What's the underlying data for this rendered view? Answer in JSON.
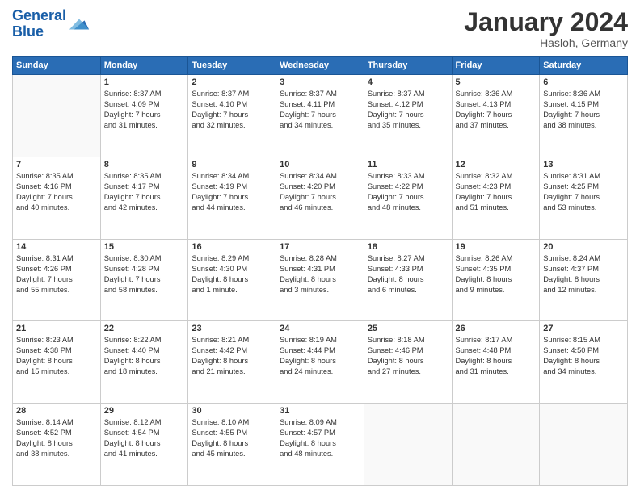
{
  "header": {
    "logo_line1": "General",
    "logo_line2": "Blue",
    "month_title": "January 2024",
    "location": "Hasloh, Germany"
  },
  "weekdays": [
    "Sunday",
    "Monday",
    "Tuesday",
    "Wednesday",
    "Thursday",
    "Friday",
    "Saturday"
  ],
  "weeks": [
    [
      {
        "day": "",
        "info": ""
      },
      {
        "day": "1",
        "info": "Sunrise: 8:37 AM\nSunset: 4:09 PM\nDaylight: 7 hours\nand 31 minutes."
      },
      {
        "day": "2",
        "info": "Sunrise: 8:37 AM\nSunset: 4:10 PM\nDaylight: 7 hours\nand 32 minutes."
      },
      {
        "day": "3",
        "info": "Sunrise: 8:37 AM\nSunset: 4:11 PM\nDaylight: 7 hours\nand 34 minutes."
      },
      {
        "day": "4",
        "info": "Sunrise: 8:37 AM\nSunset: 4:12 PM\nDaylight: 7 hours\nand 35 minutes."
      },
      {
        "day": "5",
        "info": "Sunrise: 8:36 AM\nSunset: 4:13 PM\nDaylight: 7 hours\nand 37 minutes."
      },
      {
        "day": "6",
        "info": "Sunrise: 8:36 AM\nSunset: 4:15 PM\nDaylight: 7 hours\nand 38 minutes."
      }
    ],
    [
      {
        "day": "7",
        "info": "Sunrise: 8:35 AM\nSunset: 4:16 PM\nDaylight: 7 hours\nand 40 minutes."
      },
      {
        "day": "8",
        "info": "Sunrise: 8:35 AM\nSunset: 4:17 PM\nDaylight: 7 hours\nand 42 minutes."
      },
      {
        "day": "9",
        "info": "Sunrise: 8:34 AM\nSunset: 4:19 PM\nDaylight: 7 hours\nand 44 minutes."
      },
      {
        "day": "10",
        "info": "Sunrise: 8:34 AM\nSunset: 4:20 PM\nDaylight: 7 hours\nand 46 minutes."
      },
      {
        "day": "11",
        "info": "Sunrise: 8:33 AM\nSunset: 4:22 PM\nDaylight: 7 hours\nand 48 minutes."
      },
      {
        "day": "12",
        "info": "Sunrise: 8:32 AM\nSunset: 4:23 PM\nDaylight: 7 hours\nand 51 minutes."
      },
      {
        "day": "13",
        "info": "Sunrise: 8:31 AM\nSunset: 4:25 PM\nDaylight: 7 hours\nand 53 minutes."
      }
    ],
    [
      {
        "day": "14",
        "info": "Sunrise: 8:31 AM\nSunset: 4:26 PM\nDaylight: 7 hours\nand 55 minutes."
      },
      {
        "day": "15",
        "info": "Sunrise: 8:30 AM\nSunset: 4:28 PM\nDaylight: 7 hours\nand 58 minutes."
      },
      {
        "day": "16",
        "info": "Sunrise: 8:29 AM\nSunset: 4:30 PM\nDaylight: 8 hours\nand 1 minute."
      },
      {
        "day": "17",
        "info": "Sunrise: 8:28 AM\nSunset: 4:31 PM\nDaylight: 8 hours\nand 3 minutes."
      },
      {
        "day": "18",
        "info": "Sunrise: 8:27 AM\nSunset: 4:33 PM\nDaylight: 8 hours\nand 6 minutes."
      },
      {
        "day": "19",
        "info": "Sunrise: 8:26 AM\nSunset: 4:35 PM\nDaylight: 8 hours\nand 9 minutes."
      },
      {
        "day": "20",
        "info": "Sunrise: 8:24 AM\nSunset: 4:37 PM\nDaylight: 8 hours\nand 12 minutes."
      }
    ],
    [
      {
        "day": "21",
        "info": "Sunrise: 8:23 AM\nSunset: 4:38 PM\nDaylight: 8 hours\nand 15 minutes."
      },
      {
        "day": "22",
        "info": "Sunrise: 8:22 AM\nSunset: 4:40 PM\nDaylight: 8 hours\nand 18 minutes."
      },
      {
        "day": "23",
        "info": "Sunrise: 8:21 AM\nSunset: 4:42 PM\nDaylight: 8 hours\nand 21 minutes."
      },
      {
        "day": "24",
        "info": "Sunrise: 8:19 AM\nSunset: 4:44 PM\nDaylight: 8 hours\nand 24 minutes."
      },
      {
        "day": "25",
        "info": "Sunrise: 8:18 AM\nSunset: 4:46 PM\nDaylight: 8 hours\nand 27 minutes."
      },
      {
        "day": "26",
        "info": "Sunrise: 8:17 AM\nSunset: 4:48 PM\nDaylight: 8 hours\nand 31 minutes."
      },
      {
        "day": "27",
        "info": "Sunrise: 8:15 AM\nSunset: 4:50 PM\nDaylight: 8 hours\nand 34 minutes."
      }
    ],
    [
      {
        "day": "28",
        "info": "Sunrise: 8:14 AM\nSunset: 4:52 PM\nDaylight: 8 hours\nand 38 minutes."
      },
      {
        "day": "29",
        "info": "Sunrise: 8:12 AM\nSunset: 4:54 PM\nDaylight: 8 hours\nand 41 minutes."
      },
      {
        "day": "30",
        "info": "Sunrise: 8:10 AM\nSunset: 4:55 PM\nDaylight: 8 hours\nand 45 minutes."
      },
      {
        "day": "31",
        "info": "Sunrise: 8:09 AM\nSunset: 4:57 PM\nDaylight: 8 hours\nand 48 minutes."
      },
      {
        "day": "",
        "info": ""
      },
      {
        "day": "",
        "info": ""
      },
      {
        "day": "",
        "info": ""
      }
    ]
  ]
}
